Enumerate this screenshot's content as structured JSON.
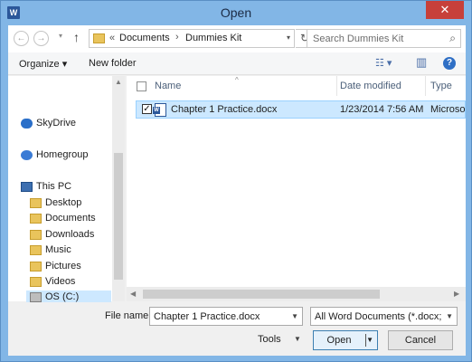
{
  "window": {
    "title": "Open",
    "app_icon_letter": "W",
    "close_glyph": "✕"
  },
  "navbar": {
    "back_glyph": "←",
    "forward_glyph": "→",
    "dropdown_glyph": "▾",
    "up_glyph": "↑",
    "address": {
      "overflow": "«",
      "segments": [
        "Documents",
        "Dummies Kit"
      ],
      "separator": "›"
    },
    "refresh_glyph": "↻",
    "search_placeholder": "Search Dummies Kit",
    "search_glyph": "⌕"
  },
  "toolbar": {
    "organize_label": "Organize ▾",
    "new_folder_label": "New folder",
    "view_glyph": "☷ ▾",
    "preview_glyph": "▥",
    "help_glyph": "?"
  },
  "nav_pane": {
    "items": [
      {
        "label": "SkyDrive",
        "icon": "cloud-icon"
      },
      {
        "label": "Homegroup",
        "icon": "homegroup-icon"
      },
      {
        "label": "This PC",
        "icon": "computer-icon"
      },
      {
        "label": "Desktop",
        "icon": "folder-icon"
      },
      {
        "label": "Documents",
        "icon": "folder-icon"
      },
      {
        "label": "Downloads",
        "icon": "folder-icon"
      },
      {
        "label": "Music",
        "icon": "music-folder-icon"
      },
      {
        "label": "Pictures",
        "icon": "folder-icon"
      },
      {
        "label": "Videos",
        "icon": "folder-icon"
      },
      {
        "label": "OS (C:)",
        "icon": "drive-icon"
      }
    ],
    "selected": "OS (C:)"
  },
  "file_list": {
    "columns": [
      "Name",
      "Date modified",
      "Type"
    ],
    "rows": [
      {
        "name": "Chapter 1 Practice.docx",
        "date_modified": "1/23/2014 7:56 AM",
        "type": "Microsoft",
        "selected": true
      }
    ]
  },
  "footer": {
    "file_name_label": "File name:",
    "file_name_value": "Chapter 1 Practice.docx",
    "file_type_value": "All Word Documents (*.docx;*.d",
    "tools_label": "Tools",
    "open_label": "Open",
    "cancel_label": "Cancel"
  },
  "colors": {
    "title_bar": "#82b6e6",
    "close_button": "#c7403a",
    "selection": "#cce8ff",
    "folder": "#e9c45c"
  }
}
